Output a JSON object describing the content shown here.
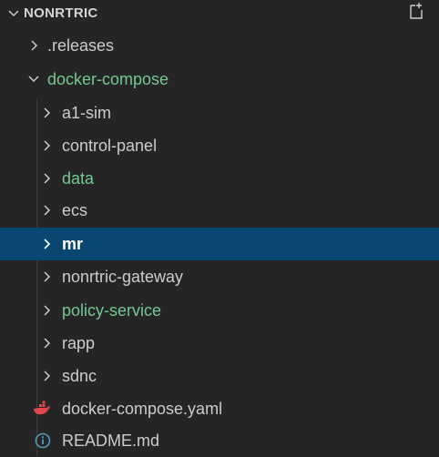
{
  "explorer": {
    "title": "NONRTRIC",
    "icons": {
      "header_chevron": "chevron-down-icon",
      "new_file": "new-file-icon"
    },
    "colors": {
      "background": "#252526",
      "selected": "#094771",
      "modified": "#73c991",
      "text": "#cccccc"
    }
  },
  "tree": [
    {
      "label": ".releases",
      "expanded": false,
      "kind": "folder",
      "status": "normal"
    },
    {
      "label": "docker-compose",
      "expanded": true,
      "kind": "folder",
      "status": "modified"
    },
    {
      "label": "a1-sim",
      "expanded": false,
      "kind": "folder",
      "status": "normal"
    },
    {
      "label": "control-panel",
      "expanded": false,
      "kind": "folder",
      "status": "normal"
    },
    {
      "label": "data",
      "expanded": false,
      "kind": "folder",
      "status": "modified"
    },
    {
      "label": "ecs",
      "expanded": false,
      "kind": "folder",
      "status": "normal"
    },
    {
      "label": "mr",
      "expanded": false,
      "kind": "folder",
      "status": "selected"
    },
    {
      "label": "nonrtric-gateway",
      "expanded": false,
      "kind": "folder",
      "status": "normal"
    },
    {
      "label": "policy-service",
      "expanded": false,
      "kind": "folder",
      "status": "modified"
    },
    {
      "label": "rapp",
      "expanded": false,
      "kind": "folder",
      "status": "normal"
    },
    {
      "label": "sdnc",
      "expanded": false,
      "kind": "folder",
      "status": "normal"
    },
    {
      "label": "docker-compose.yaml",
      "kind": "file",
      "icon": "docker-whale-icon",
      "status": "normal"
    },
    {
      "label": "README.md",
      "kind": "file",
      "icon": "info-icon",
      "status": "normal"
    }
  ]
}
